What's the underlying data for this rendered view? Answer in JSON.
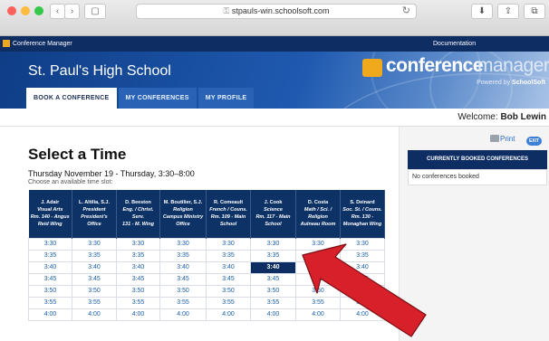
{
  "browser": {
    "url": "stpauls-win.schoolsoft.com",
    "back": "‹",
    "forward": "›",
    "sidebar": "▢",
    "reload": "↻",
    "download": "⬇",
    "share": "⇪",
    "tabs": "⧉"
  },
  "app_bar": {
    "name": "Conference Manager",
    "documentation": "Documentation"
  },
  "header": {
    "school": "St. Paul's High School",
    "logo_bold": "conference",
    "logo_light": "manager",
    "powered_prefix": "Powered by",
    "powered_brand": "SchoolSoft"
  },
  "tabs": [
    {
      "label": "BOOK A CONFERENCE"
    },
    {
      "label": "MY CONFERENCES"
    },
    {
      "label": "MY PROFILE"
    }
  ],
  "welcome": {
    "prefix": "Welcome:",
    "name": "Bob Lewin"
  },
  "main": {
    "title": "Select a Time",
    "date_line": "Thursday November 19 - Thursday, 3:30–8:00",
    "instruction": "Choose an available time slot:"
  },
  "grid": {
    "columns": [
      {
        "name": "J. Adair",
        "subject": "Visual Arts",
        "room": "Rm. 140 - Angus Reid Wing"
      },
      {
        "name": "L. Altilia, S.J.",
        "subject": "President",
        "room": "President's Office"
      },
      {
        "name": "D. Beeston",
        "subject": "Eng. / Christ. Serv.",
        "room": "131 - M. Wing"
      },
      {
        "name": "M. Boutilier, S.J.",
        "subject": "Religion",
        "room": "Campus Ministry Office"
      },
      {
        "name": "R. Comeault",
        "subject": "French / Couns.",
        "room": "Rm. 109 - Main School"
      },
      {
        "name": "J. Cook",
        "subject": "Science",
        "room": "Rm. 117 - Main School"
      },
      {
        "name": "D. Costa",
        "subject": "Math / Sci. / Religion",
        "room": "Aulneau Room"
      },
      {
        "name": "S. Deinard",
        "subject": "Soc. St. / Couns.",
        "room": "Rm. 130 - Monaghan Wing"
      }
    ],
    "rows": [
      [
        "3:30",
        "3:30",
        "3:30",
        "3:30",
        "3:30",
        "3:30",
        "3:30",
        "3:30"
      ],
      [
        "3:35",
        "3:35",
        "3:35",
        "3:35",
        "3:35",
        "3:35",
        "3:35",
        "3:35"
      ],
      [
        "3:40",
        "3:40",
        "3:40",
        "3:40",
        "3:40",
        "3:40",
        "3:40",
        "3:40"
      ],
      [
        "3:45",
        "3:45",
        "3:45",
        "3:45",
        "3:45",
        "3:45",
        "3:45",
        "3:45"
      ],
      [
        "3:50",
        "3:50",
        "3:50",
        "3:50",
        "3:50",
        "3:50",
        "3:50",
        "3:50"
      ],
      [
        "3:55",
        "3:55",
        "3:55",
        "3:55",
        "3:55",
        "3:55",
        "3:55",
        "3:55"
      ],
      [
        "4:00",
        "4:00",
        "4:00",
        "4:00",
        "4:00",
        "4:00",
        "4:00",
        "4:00"
      ]
    ],
    "selected": {
      "row": 2,
      "col": 5
    }
  },
  "side": {
    "print": "Print",
    "exit": "EXIT",
    "booked_title": "CURRENTLY BOOKED CONFERENCES",
    "booked_empty": "No conferences booked"
  },
  "colors": {
    "navy": "#0d2d63",
    "accent": "#f0a81c",
    "link": "#1a5fa8",
    "arrow": "#d8202a"
  }
}
